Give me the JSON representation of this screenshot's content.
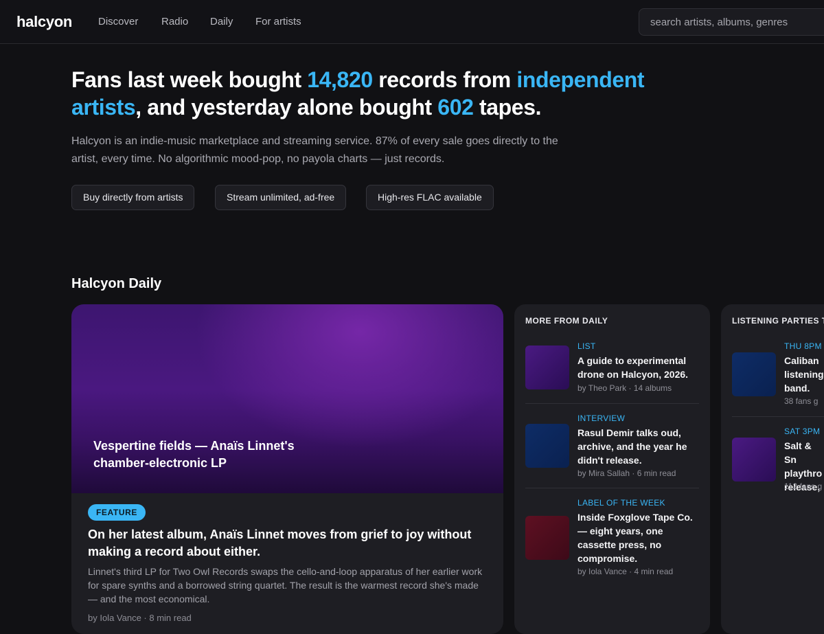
{
  "nav": {
    "logo": "halcyon",
    "links": [
      "Discover",
      "Radio",
      "Daily",
      "For artists"
    ],
    "search_placeholder": "search artists, albums, genres"
  },
  "hero": {
    "title_parts": [
      {
        "text": "Fans last week bought ",
        "accent": false
      },
      {
        "text": "14,820",
        "accent": true
      },
      {
        "text": " records from ",
        "accent": false
      },
      {
        "text": "independent artists",
        "accent": true
      },
      {
        "text": ", and yesterday alone bought ",
        "accent": false
      },
      {
        "text": "602",
        "accent": true
      },
      {
        "text": " tapes.",
        "accent": false
      }
    ],
    "subtitle": "Halcyon is an indie-music marketplace and streaming service. 87% of every sale goes directly to the artist, every time. No algorithmic mood-pop, no payola charts — just records.",
    "pills": [
      "Buy directly from artists",
      "Stream unlimited, ad-free",
      "High-res FLAC available"
    ]
  },
  "daily": {
    "section_title": "Halcyon Daily",
    "feature": {
      "image_title": "Vespertine fields — Anaïs Linnet's chamber-electronic LP",
      "badge": "FEATURE",
      "headline": "On her latest album, Anaïs Linnet moves from grief to joy without making a record about either.",
      "description": "Linnet's third LP for Two Owl Records swaps the cello-and-loop apparatus of her earlier work for spare synths and a borrowed string quartet. The result is the warmest record she's made — and the most economical.",
      "byline": "by Iola Vance · 8 min read"
    },
    "more": {
      "heading": "MORE FROM DAILY",
      "items": [
        {
          "tag": "LIST",
          "title": "A guide to experimental drone on Halcyon, 2026.",
          "meta": "by Theo Park · 14 albums",
          "thumb": "purple"
        },
        {
          "tag": "INTERVIEW",
          "title": "Rasul Demir talks oud, archive, and the year he didn't release.",
          "meta": "by Mira Sallah · 6 min read",
          "thumb": "blue"
        },
        {
          "tag": "LABEL OF THE WEEK",
          "title": "Inside Foxglove Tape Co. — eight years, one cassette press, no compromise.",
          "meta": "by Iola Vance · 4 min read",
          "thumb": "red"
        }
      ]
    },
    "parties": {
      "heading": "LISTENING PARTIES T",
      "items": [
        {
          "tag": "THU 8PM",
          "title": "Caliban listening band.",
          "meta": "38 fans g",
          "thumb": "blue"
        },
        {
          "tag": "SAT 3PM",
          "title": "Salt & Sn playthro release,",
          "meta": "112 fans g",
          "thumb": "purple"
        }
      ]
    }
  },
  "colors": {
    "accent": "#3ab6f5",
    "background": "#111114",
    "card": "#1e1e23"
  }
}
